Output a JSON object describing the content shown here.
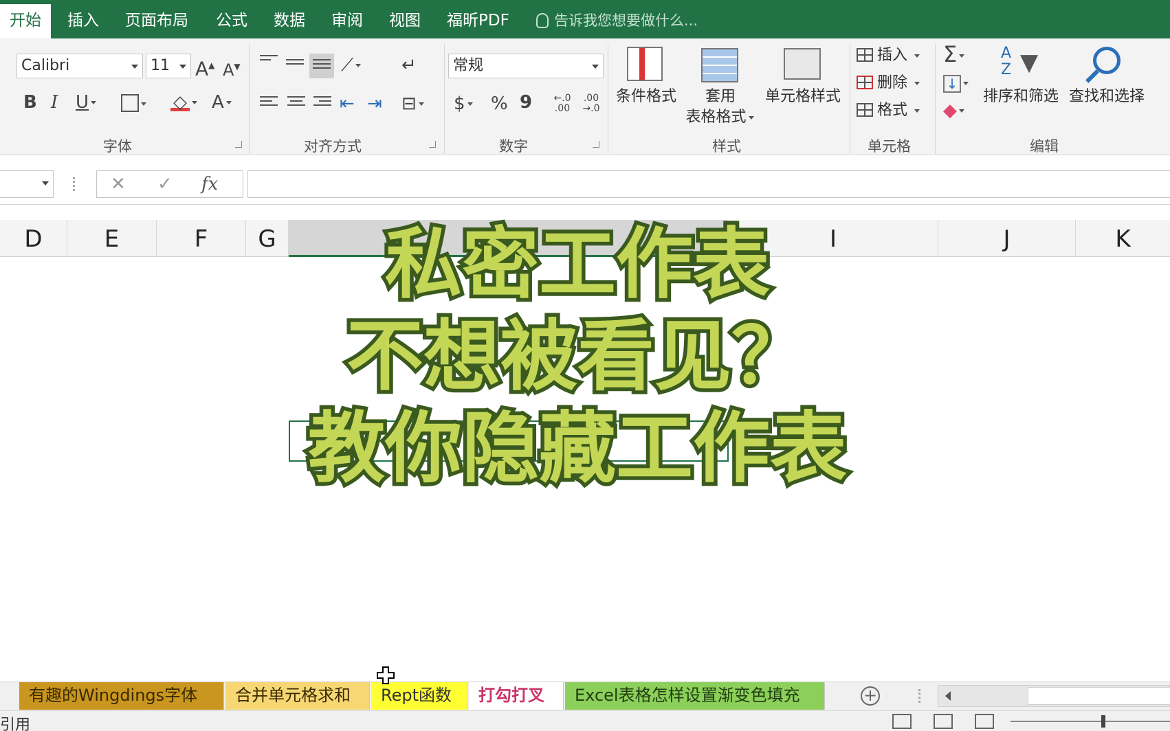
{
  "ribbon_tabs": [
    {
      "label": "开始",
      "active": true
    },
    {
      "label": "插入"
    },
    {
      "label": "页面布局"
    },
    {
      "label": "公式"
    },
    {
      "label": "数据"
    },
    {
      "label": "审阅"
    },
    {
      "label": "视图"
    },
    {
      "label": "福昕PDF"
    }
  ],
  "tell_me": "告诉我您想要做什么...",
  "font": {
    "name": "Calibri",
    "size": "11",
    "grow": "A",
    "shrink": "A",
    "bold": "B",
    "italic": "I",
    "underline": "U",
    "color_glyph": "A",
    "group_label": "字体"
  },
  "alignment": {
    "group_label": "对齐方式"
  },
  "number": {
    "format": "常规",
    "currency": "$",
    "percent": "%",
    "comma": "9",
    "inc_decimal": "←.0 .00",
    "dec_decimal": ".00 →.0",
    "group_label": "数字"
  },
  "styles": {
    "conditional": "条件格式",
    "table_line1": "套用",
    "table_line2": "表格格式",
    "cell_styles": "单元格样式",
    "group_label": "样式"
  },
  "cells": {
    "insert": "插入",
    "delete": "删除",
    "format": "格式",
    "group_label": "单元格"
  },
  "editing": {
    "sum": "Σ",
    "sort_filter": "排序和筛选",
    "find_select": "查找和选择",
    "group_label": "编辑"
  },
  "formula_bar": {
    "cancel": "✕",
    "enter": "✓",
    "fx": "fx"
  },
  "columns": [
    "D",
    "E",
    "F",
    "G",
    "",
    "I",
    "J",
    "K"
  ],
  "headline": [
    "私密工作表",
    "不想被看见？",
    "教你隐藏工作表"
  ],
  "sheet_tabs": [
    {
      "label": "有趣的Wingdings字体",
      "bg": "#c9961f",
      "color": "#3a2a00"
    },
    {
      "label": "合并单元格求和",
      "bg": "#f7d774",
      "color": "#3a2a00"
    },
    {
      "label": "Rept函数",
      "bg": "#ffff33",
      "color": "#333333"
    },
    {
      "label": "打勾打叉",
      "bg": "#ffffff",
      "color": "#cc3366"
    },
    {
      "label": "Excel表格怎样设置渐变色填充",
      "bg": "#8ccf5a",
      "color": "#1f3f10"
    }
  ],
  "add_sheet": "+",
  "status": "引用",
  "colors": {
    "accent": "#217346",
    "headline_fill": "#c4d656",
    "headline_stroke": "#3b5a1f"
  }
}
